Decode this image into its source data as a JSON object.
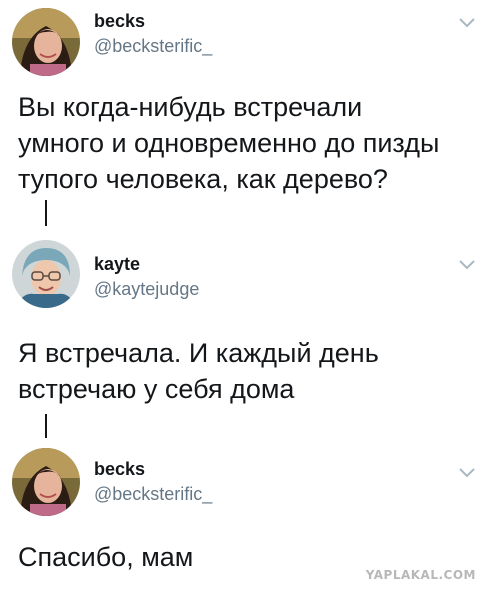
{
  "tweets": [
    {
      "display_name": "becks",
      "handle": "@becksterific_",
      "text": "Вы когда-нибудь встречали\nумного и одновременно до пизды\nтупого человека, как дерево?"
    },
    {
      "display_name": "kayte",
      "handle": "@kaytejudge",
      "text": "Я встречала. И каждый день\nвстречаю у себя дома"
    },
    {
      "display_name": "becks",
      "handle": "@becksterific_",
      "text": "Спасибо, мам"
    }
  ],
  "icons": {
    "menu": "chevron-down-icon",
    "avatar": "profile-photo"
  },
  "watermark": "YAPLAKAL.COM",
  "colors": {
    "name": "#14171a",
    "handle": "#657786",
    "chevron": "#aab8c2",
    "watermark": "#b8b8b8"
  }
}
